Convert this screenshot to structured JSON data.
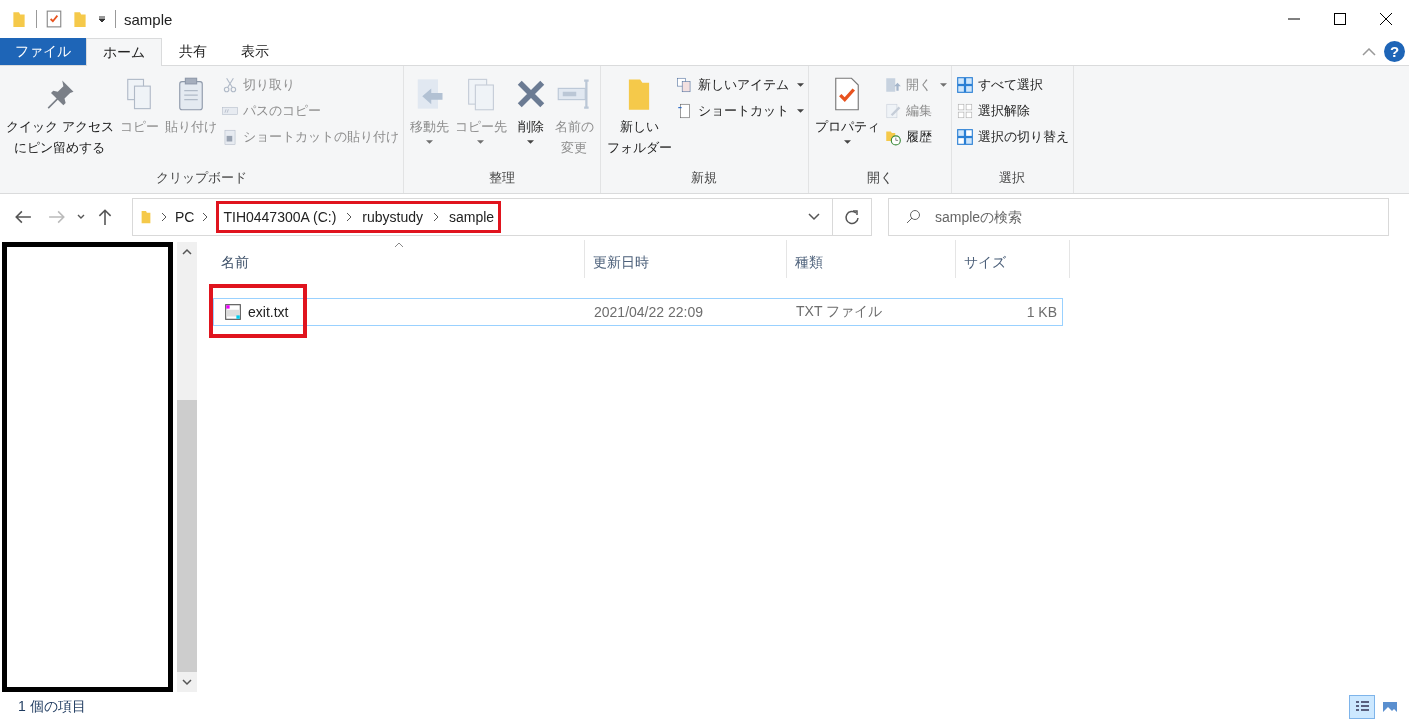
{
  "window": {
    "title": "sample"
  },
  "ribbon_tabs": [
    {
      "label": "ファイル",
      "kind": "file",
      "selected": false
    },
    {
      "label": "ホーム",
      "kind": "tab",
      "selected": true
    },
    {
      "label": "共有",
      "kind": "tab",
      "selected": false
    },
    {
      "label": "表示",
      "kind": "tab",
      "selected": false
    }
  ],
  "help": {
    "label": "?"
  },
  "ribbon_groups": [
    {
      "label": "クリップボード",
      "items": [
        {
          "lines": [
            "クイック アクセス",
            "にピン留めする"
          ],
          "kind": "large",
          "disabled": false,
          "dropdown": false
        },
        {
          "lines": [
            "コピー"
          ],
          "kind": "large",
          "disabled": true,
          "dropdown": false
        },
        {
          "lines": [
            "貼り付け"
          ],
          "kind": "large",
          "disabled": true,
          "dropdown": false
        },
        {
          "lines": [
            "切り取り"
          ],
          "kind": "small",
          "disabled": true,
          "dropdown": false
        },
        {
          "lines": [
            "パスのコピー"
          ],
          "kind": "small",
          "disabled": true,
          "dropdown": false
        },
        {
          "lines": [
            "ショートカットの貼り付け"
          ],
          "kind": "small",
          "disabled": true,
          "dropdown": false
        }
      ]
    },
    {
      "label": "整理",
      "items": [
        {
          "lines": [
            "移動先"
          ],
          "kind": "large",
          "disabled": true,
          "dropdown": true
        },
        {
          "lines": [
            "コピー先"
          ],
          "kind": "large",
          "disabled": true,
          "dropdown": true
        },
        {
          "lines": [
            "削除"
          ],
          "kind": "large",
          "disabled": false,
          "dropdown": true
        },
        {
          "lines": [
            "名前の",
            "変更"
          ],
          "kind": "large",
          "disabled": true,
          "dropdown": false
        }
      ]
    },
    {
      "label": "新規",
      "items": [
        {
          "lines": [
            "新しい",
            "フォルダー"
          ],
          "kind": "large",
          "disabled": false,
          "dropdown": false
        },
        {
          "lines": [
            "新しいアイテム"
          ],
          "kind": "small",
          "disabled": false,
          "dropdown": true
        },
        {
          "lines": [
            "ショートカット"
          ],
          "kind": "small",
          "disabled": false,
          "dropdown": true
        }
      ]
    },
    {
      "label": "開く",
      "items": [
        {
          "lines": [
            "プロパティ"
          ],
          "kind": "large",
          "disabled": false,
          "dropdown": true
        },
        {
          "lines": [
            "開く"
          ],
          "kind": "small",
          "disabled": true,
          "dropdown": true
        },
        {
          "lines": [
            "編集"
          ],
          "kind": "small",
          "disabled": true,
          "dropdown": false
        },
        {
          "lines": [
            "履歴"
          ],
          "kind": "small",
          "disabled": false,
          "dropdown": false
        }
      ]
    },
    {
      "label": "選択",
      "items": [
        {
          "lines": [
            "すべて選択"
          ],
          "kind": "small",
          "disabled": false,
          "dropdown": false
        },
        {
          "lines": [
            "選択解除"
          ],
          "kind": "small",
          "disabled": false,
          "dropdown": false
        },
        {
          "lines": [
            "選択の切り替え"
          ],
          "kind": "small",
          "disabled": false,
          "dropdown": false
        }
      ]
    }
  ],
  "navigation": {
    "back_disabled": false,
    "forward_disabled": true
  },
  "address": {
    "crumbs": [
      {
        "label": "PC",
        "highlighted": false
      },
      {
        "label": "TIH0447300A (C:)",
        "highlighted": true
      },
      {
        "label": "rubystudy",
        "highlighted": true
      },
      {
        "label": "sample",
        "highlighted": true
      }
    ]
  },
  "search": {
    "placeholder": "sampleの検索"
  },
  "file_list": {
    "columns": [
      {
        "label": "名前",
        "sorted": true
      },
      {
        "label": "更新日時",
        "sorted": false
      },
      {
        "label": "種類",
        "sorted": false
      },
      {
        "label": "サイズ",
        "sorted": false
      }
    ],
    "rows": [
      {
        "name": "exit.txt",
        "modified": "2021/04/22 22:09",
        "type": "TXT ファイル",
        "size": "1 KB",
        "focused": true,
        "highlighted": true
      }
    ]
  },
  "status_bar": {
    "text": "1 個の項目",
    "views": [
      {
        "kind": "details",
        "selected": true
      },
      {
        "kind": "thumbnails",
        "selected": false
      }
    ]
  }
}
